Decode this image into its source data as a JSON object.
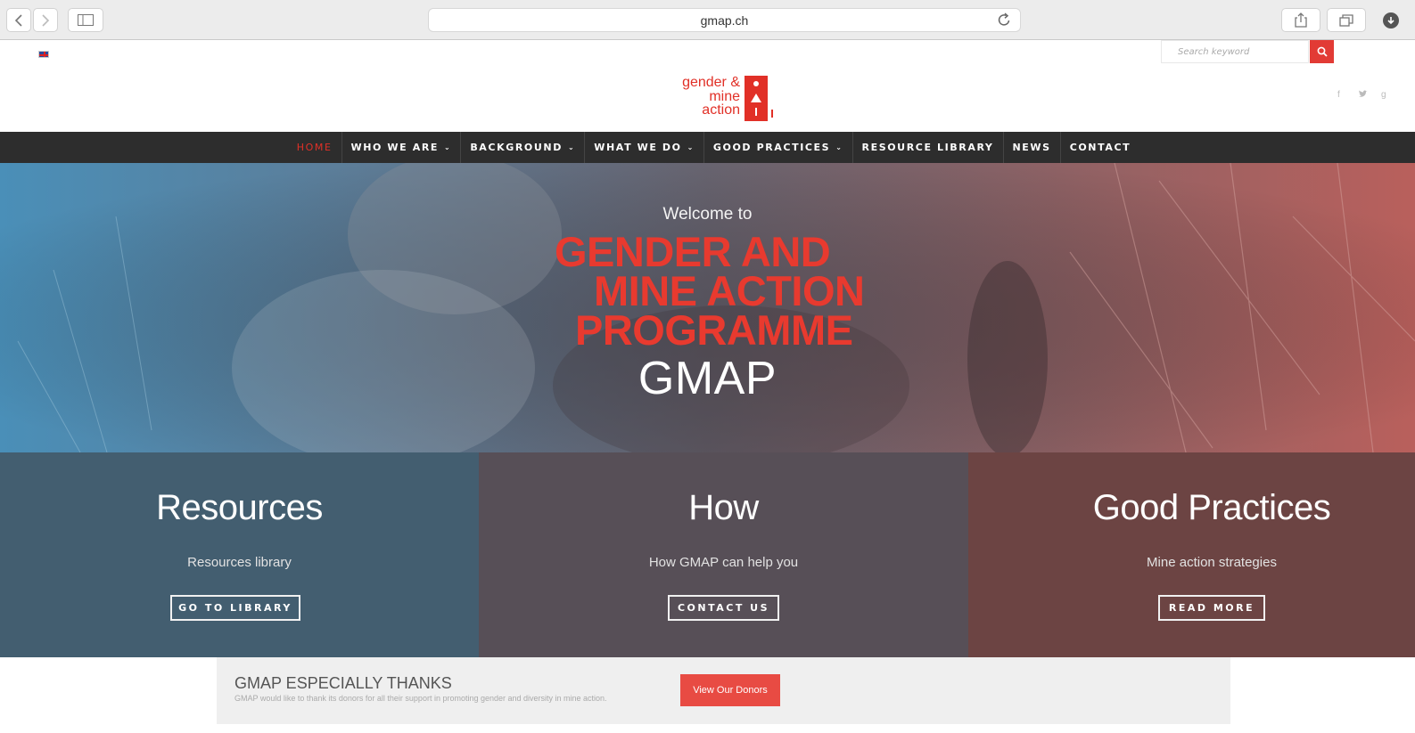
{
  "browser": {
    "url": "gmap.ch",
    "icons": [
      "back-icon",
      "forward-icon",
      "sidebar-icon",
      "reload-icon",
      "share-icon",
      "tabs-icon",
      "download-icon"
    ]
  },
  "header": {
    "language_flag": "flag-uk-icon",
    "search_placeholder": "Search keyword",
    "social": [
      "f",
      "t",
      "g"
    ],
    "logo_lines": [
      "gender &",
      "mine",
      "action"
    ]
  },
  "nav": {
    "items": [
      {
        "label": "HOME",
        "active": true,
        "dropdown": false
      },
      {
        "label": "WHO WE ARE",
        "dropdown": true
      },
      {
        "label": "BACKGROUND",
        "dropdown": true
      },
      {
        "label": "WHAT WE DO",
        "dropdown": true
      },
      {
        "label": "GOOD PRACTICES",
        "dropdown": true
      },
      {
        "label": "RESOURCE LIBRARY",
        "dropdown": false
      },
      {
        "label": "NEWS",
        "dropdown": false
      },
      {
        "label": "CONTACT",
        "dropdown": false
      }
    ]
  },
  "hero": {
    "welcome": "Welcome to",
    "title_lines": [
      "GENDER AND",
      "MINE ACTION",
      "PROGRAMME"
    ],
    "acronym": "GMAP"
  },
  "panels": [
    {
      "title": "Resources",
      "subtitle": "Resources library",
      "button": "GO TO LIBRARY",
      "color": "#435e70"
    },
    {
      "title": "How",
      "subtitle": "How GMAP can help you",
      "button": "CONTACT US",
      "color": "#574f57"
    },
    {
      "title": "Good Practices",
      "subtitle": "Mine action strategies",
      "button": "READ MORE",
      "color": "#6c4443"
    }
  ],
  "thanks": {
    "title": "GMAP ESPECIALLY THANKS",
    "subtitle": "GMAP would like to thank its donors for all their support in promoting gender and diversity in mine action.",
    "button": "View Our Donors"
  },
  "colors": {
    "accent": "#e13027",
    "nav_bg": "#2d2d2d"
  }
}
